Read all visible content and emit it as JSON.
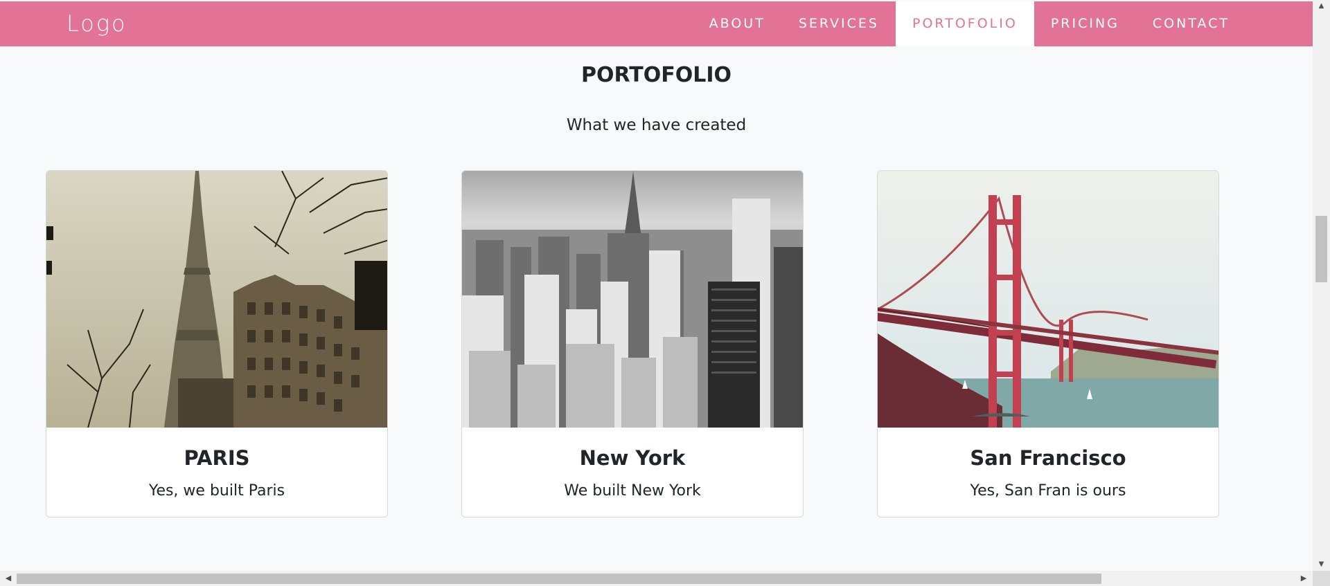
{
  "header": {
    "logo": "Logo",
    "nav": [
      {
        "label": "ABOUT"
      },
      {
        "label": "SERVICES"
      },
      {
        "label": "PORTOFOLIO"
      },
      {
        "label": "PRICING"
      },
      {
        "label": "CONTACT"
      }
    ],
    "active": "PORTOFOLIO",
    "color": "#e37396"
  },
  "section": {
    "title": "PORTOFOLIO",
    "subtitle": "What we have created"
  },
  "cards": [
    {
      "title": "PARIS",
      "text": "Yes, we built Paris"
    },
    {
      "title": "New York",
      "text": "We built New York"
    },
    {
      "title": "San Francisco",
      "text": "Yes, San Fran is ours"
    }
  ]
}
